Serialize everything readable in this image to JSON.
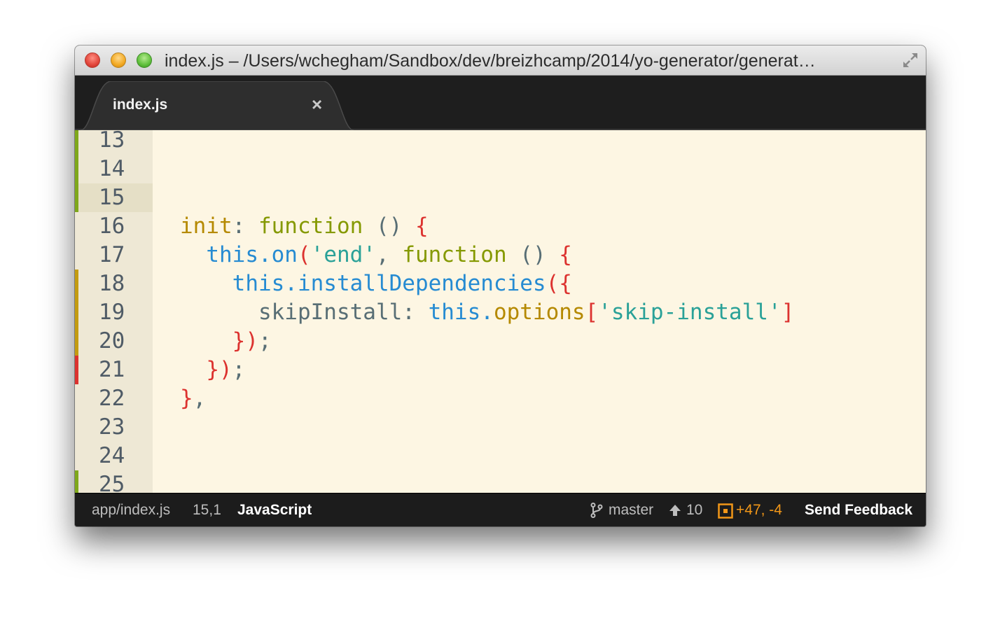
{
  "window": {
    "title": "index.js – /Users/wchegham/Sandbox/dev/breizhcamp/2014/yo-generator/generat…"
  },
  "tab": {
    "label": "index.js",
    "close_glyph": "×"
  },
  "gutter": {
    "lines": [
      "13",
      "14",
      "15",
      "16",
      "17",
      "18",
      "19",
      "20",
      "21",
      "22",
      "23",
      "24",
      "25"
    ],
    "active_line": "15",
    "markers": [
      {
        "line": "13",
        "status": "added",
        "color": "#7fa81b"
      },
      {
        "line": "14",
        "status": "added",
        "color": "#7fa81b"
      },
      {
        "line": "15",
        "status": "added",
        "color": "#7fa81b"
      },
      {
        "line": "18",
        "status": "modified",
        "color": "#c49c10"
      },
      {
        "line": "19",
        "status": "modified",
        "color": "#c49c10"
      },
      {
        "line": "20",
        "status": "modified",
        "color": "#c49c10"
      },
      {
        "line": "21",
        "status": "deleted",
        "color": "#dc322f"
      },
      {
        "line": "25",
        "status": "added",
        "color": "#7fa81b"
      }
    ]
  },
  "code": {
    "line16": {
      "t1": "init",
      "t2": ": ",
      "t3": "function",
      "t4": " () ",
      "t5": "{"
    },
    "line17": {
      "t1": "  ",
      "t2": "this",
      "t3": ".on",
      "t4": "(",
      "t5": "'end'",
      "t6": ", ",
      "t7": "function",
      "t8": " () ",
      "t9": "{"
    },
    "line18": {
      "t1": "    ",
      "t2": "this",
      "t3": ".installDependencies",
      "t4": "({"
    },
    "line19": {
      "t1": "      skipInstall: ",
      "t2": "this",
      "t3": ".",
      "t4": "options",
      "t5": "[",
      "t6": "'skip-install'",
      "t7": "]"
    },
    "line20": {
      "t1": "    ",
      "t2": "})",
      "t3": ";"
    },
    "line21": {
      "t1": "  ",
      "t2": "})",
      "t3": ";"
    },
    "line22": {
      "t1": "}",
      "t2": ","
    }
  },
  "colors": {
    "background": "#fdf6e3",
    "gutter": "#eee8d5",
    "keyword": "#859900",
    "this": "#268bd2",
    "string": "#2aa198",
    "brace": "#dc322f",
    "property": "#b58900",
    "plain": "#586e75",
    "title_label": "#b58900"
  },
  "status": {
    "path": "app/index.js",
    "cursor": "15,1",
    "syntax": "JavaScript",
    "branch": "master",
    "ahead": "10",
    "diff": "+47, -4",
    "feedback": "Send Feedback"
  },
  "icons": {
    "fullscreen": "fullscreen-icon",
    "branch": "git-branch-icon",
    "ahead": "arrow-up-icon",
    "diff": "diff-box-icon"
  }
}
